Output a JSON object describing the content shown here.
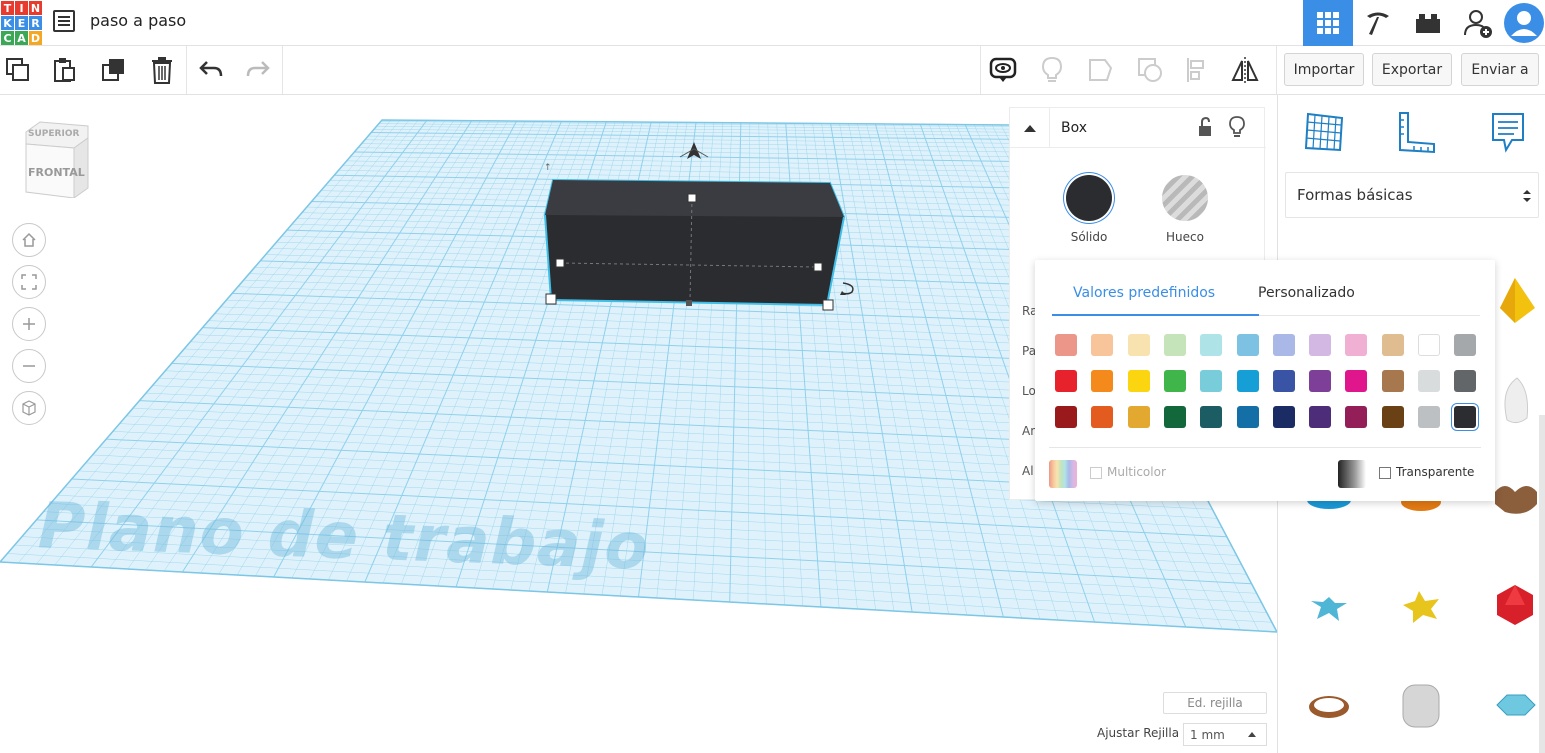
{
  "header": {
    "logo_letters": [
      "T",
      "I",
      "N",
      "K",
      "E",
      "R",
      "C",
      "A",
      "D"
    ],
    "logo_colors": [
      "#e83b2d",
      "#e83b2d",
      "#e83b2d",
      "#3a8ee6",
      "#3a8ee6",
      "#3a8ee6",
      "#3aa856",
      "#3aa856",
      "#f5a623"
    ],
    "doc_title": "paso a paso",
    "accent": "#3a8ee6"
  },
  "toolbar": {
    "import_label": "Importar",
    "export_label": "Exportar",
    "send_label": "Enviar a"
  },
  "viewcube": {
    "top_face": "SUPERIOR",
    "front_face": "FRONTAL"
  },
  "workspace": {
    "plane_label": "Plano de trabajo",
    "edit_grid_label": "Ed. rejilla",
    "snap_label": "Ajustar Rejilla",
    "snap_value": "1 mm",
    "object_color": "#2a2c30",
    "grid_color": "#8fd0ec"
  },
  "inspector": {
    "title": "Box",
    "solid_label": "Sólido",
    "hole_label": "Hueco",
    "props": [
      "Ra",
      "Pa",
      "Lo",
      "An",
      "Al"
    ]
  },
  "color_popup": {
    "tab_presets": "Valores predefinidos",
    "tab_custom": "Personalizado",
    "multicolor_label": "Multicolor",
    "transparent_label": "Transparente",
    "rows": [
      [
        "#ec968a",
        "#f8c499",
        "#f8e3b0",
        "#c5e4ba",
        "#aee4e8",
        "#7dc2e2",
        "#aab8e8",
        "#d4b8e4",
        "#f0b0d4",
        "#e0bd90",
        "#ffffff",
        "#a5a8ab"
      ],
      [
        "#e8222c",
        "#f48a1c",
        "#fbd510",
        "#3fb54a",
        "#79cddb",
        "#159fd6",
        "#3954a4",
        "#7d3f98",
        "#e0168c",
        "#a7784e",
        "#d9dcdd",
        "#636669"
      ],
      [
        "#9a1a1c",
        "#e45b20",
        "#e3a830",
        "#12683a",
        "#1b5d63",
        "#136fa5",
        "#1b2c64",
        "#4d2c7a",
        "#941f58",
        "#6a4114",
        "#bcc0c2",
        "#2b2d31"
      ]
    ],
    "selected_color": "#2b2d31"
  },
  "rightpanel": {
    "category": "Formas básicas"
  }
}
